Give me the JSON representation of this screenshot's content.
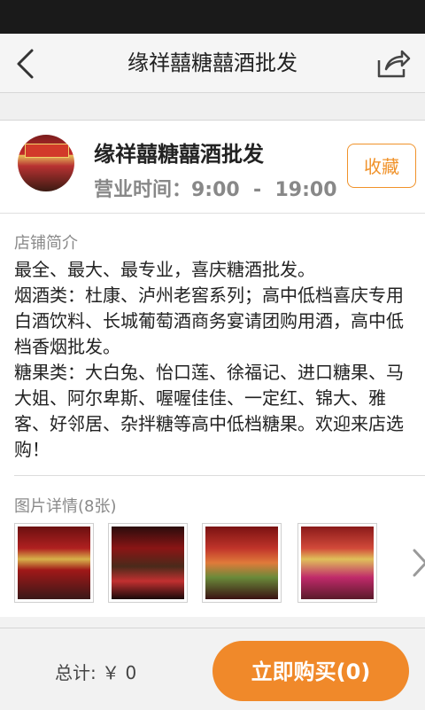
{
  "header": {
    "title": "缘祥囍糖囍酒批发",
    "back_icon": "chevron-left-icon",
    "share_icon": "share-icon"
  },
  "shop": {
    "name": "缘祥囍糖囍酒批发",
    "hours": "营业时间：9:00  -  19:00",
    "favorite_label": "收藏",
    "accent_color": "#f0892a"
  },
  "intro": {
    "title": "店铺简介",
    "text": "最全、最大、最专业，喜庆糖酒批发。\n烟酒类：杜康、泸州老窖系列；高中低档喜庆专用白酒饮料、长城葡萄酒商务宴请团购用酒，高中低档香烟批发。\n糖果类：大白兔、怡口莲、徐福记、进口糖果、马大姐、阿尔卑斯、喔喔佳佳、一定红、锦大、雅客、好邻居、杂拌糖等高中低档糖果。欢迎来店选购！"
  },
  "photos": {
    "title": "图片详情(8张)",
    "items": [
      "photo-1",
      "photo-2",
      "photo-3",
      "photo-4"
    ]
  },
  "footer": {
    "total": "总计: ￥ 0",
    "buy_label": "立即购买(0)"
  }
}
